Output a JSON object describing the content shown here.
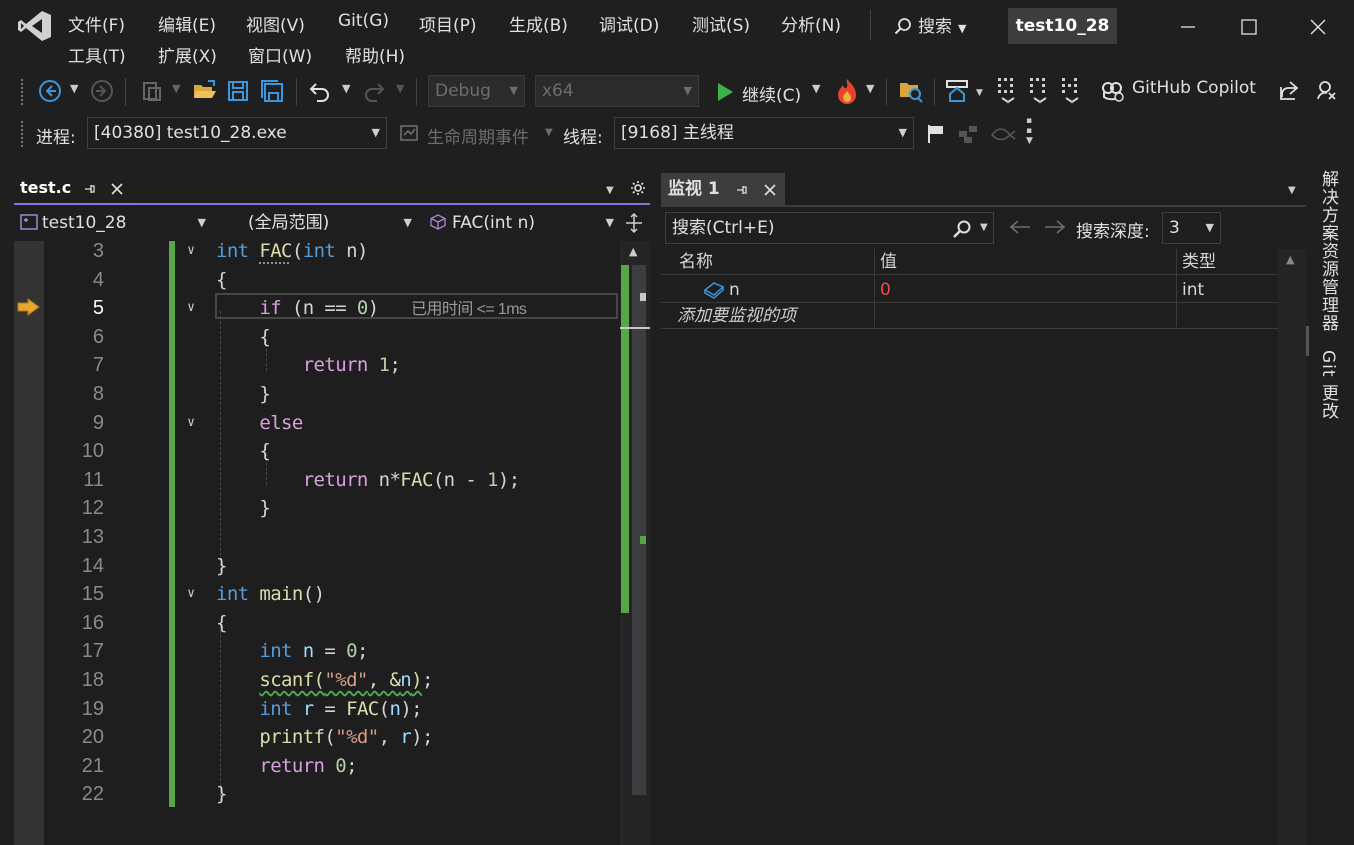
{
  "menu": {
    "file": "文件(F)",
    "edit": "编辑(E)",
    "view": "视图(V)",
    "git": "Git(G)",
    "project": "项目(P)",
    "build": "生成(B)",
    "debug": "调试(D)",
    "test": "测试(S)",
    "analyze": "分析(N)",
    "tools": "工具(T)",
    "extensions": "扩展(X)",
    "window": "窗口(W)",
    "help": "帮助(H)"
  },
  "search": {
    "label": "搜索"
  },
  "project_name": "test10_28",
  "toolbar": {
    "config": "Debug",
    "platform": "x64",
    "continue_label": "继续(C)",
    "copilot_label": "GitHub Copilot",
    "process_label": "进程:",
    "process_value": "[40380] test10_28.exe",
    "lifecycle_label": "生命周期事件",
    "thread_label": "线程:",
    "thread_value": "[9168] 主线程"
  },
  "editor": {
    "tab_label": "test.c",
    "nav_project": "test10_28",
    "nav_scope": "(全局范围)",
    "nav_function": "FAC(int n)",
    "inline_hint": "已用时间 <= 1ms",
    "line_numbers": [
      "3",
      "4",
      "5",
      "6",
      "7",
      "8",
      "9",
      "10",
      "11",
      "12",
      "13",
      "14",
      "15",
      "16",
      "17",
      "18",
      "19",
      "20",
      "21",
      "22"
    ]
  },
  "watch": {
    "tab_label": "监视 1",
    "search_placeholder": "搜索(Ctrl+E)",
    "depth_label": "搜索深度:",
    "depth_value": "3",
    "columns": {
      "name": "名称",
      "value": "值",
      "type": "类型"
    },
    "rows": [
      {
        "name": "n",
        "value": "0",
        "type": "int"
      }
    ],
    "add_item_placeholder": "添加要监视的项"
  },
  "side_dock": {
    "solution_explorer": "解决方案资源管理器",
    "git_changes": "Git 更改"
  },
  "colors": {
    "accent": "#8c6fe0",
    "change_bar": "#57a64a",
    "keyword": "#569cd6",
    "control": "#d8a0df",
    "function": "#dcdcaa",
    "string": "#d69d85",
    "number": "#b5cea8",
    "watch_value_changed": "#f14c4c"
  }
}
